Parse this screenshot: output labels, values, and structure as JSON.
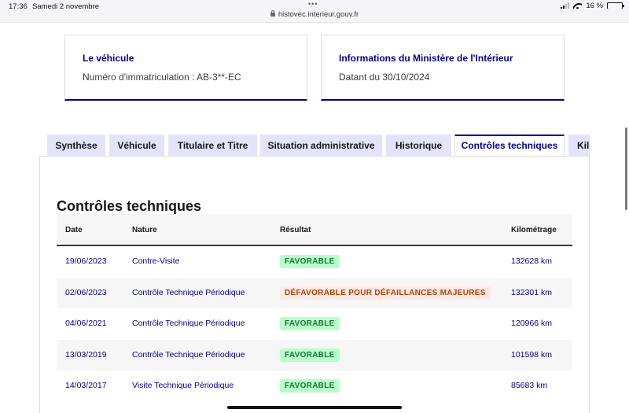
{
  "status_bar": {
    "time": "17:36",
    "date": "Samedi 2 novembre",
    "battery": "16 %",
    "battery_level": 0.16
  },
  "browser": {
    "url": "histovec.interieur.gouv.fr"
  },
  "cards": [
    {
      "title": "Le véhicule",
      "description": "Numéro d'immatriculation : AB-3**-EC"
    },
    {
      "title": "Informations du Ministère de l'Intérieur",
      "description": "Datant du 30/10/2024"
    }
  ],
  "tabs": [
    {
      "label": "Synthèse",
      "active": false
    },
    {
      "label": "Véhicule",
      "active": false
    },
    {
      "label": "Titulaire et Titre",
      "active": false
    },
    {
      "label": "Situation administrative",
      "active": false
    },
    {
      "label": "Historique",
      "active": false
    },
    {
      "label": "Contrôles techniques",
      "active": true
    },
    {
      "label": "Kil",
      "active": false
    }
  ],
  "section": {
    "title": "Contrôles techniques"
  },
  "table": {
    "headers": {
      "date": "Date",
      "nature": "Nature",
      "result": "Résultat",
      "mileage": "Kilométrage"
    },
    "rows": [
      {
        "date": "19/06/2023",
        "nature": "Contre-Visite",
        "result": "FAVORABLE",
        "status": "ok",
        "mileage": "132628 km"
      },
      {
        "date": "02/06/2023",
        "nature": "Contrôle Technique Périodique",
        "result": "DÉFAVORABLE POUR DÉFAILLANCES MAJEURES",
        "status": "ko",
        "mileage": "132301 km"
      },
      {
        "date": "04/06/2021",
        "nature": "Contrôle Technique Périodique",
        "result": "FAVORABLE",
        "status": "ok",
        "mileage": "120966 km"
      },
      {
        "date": "13/03/2019",
        "nature": "Contrôle Technique Périodique",
        "result": "FAVORABLE",
        "status": "ok",
        "mileage": "101598 km"
      },
      {
        "date": "14/03/2017",
        "nature": "Visite Technique Périodique",
        "result": "FAVORABLE",
        "status": "ok",
        "mileage": "85683 km"
      }
    ]
  },
  "colors": {
    "primary": "#000091",
    "tab_inactive": "#e3e3fd",
    "favorable_bg": "#b8fec9",
    "favorable_text": "#18753c",
    "defavorable_bg": "#ffe9e6",
    "defavorable_text": "#b34000"
  }
}
